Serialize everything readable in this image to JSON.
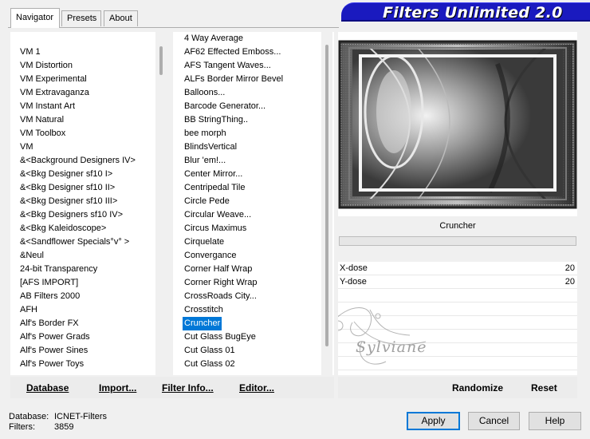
{
  "tabs": [
    {
      "label": "Navigator",
      "active": true
    },
    {
      "label": "Presets",
      "active": false
    },
    {
      "label": "About",
      "active": false
    }
  ],
  "banner_title": "Filters Unlimited 2.0",
  "categories": [
    "VM 1",
    "VM Distortion",
    "VM Experimental",
    "VM Extravaganza",
    "VM Instant Art",
    "VM Natural",
    "VM Toolbox",
    "VM",
    "&<Background Designers IV>",
    "&<Bkg Designer sf10 I>",
    "&<Bkg Designer sf10 II>",
    "&<Bkg Designer sf10 III>",
    "&<Bkg Designers sf10 IV>",
    "&<Bkg Kaleidoscope>",
    "&<Sandflower Specials°v° >",
    "&Neul",
    "24-bit Transparency",
    "[AFS IMPORT]",
    "AB Filters 2000",
    "AFH",
    "Alf's Border FX",
    "Alf's Power Grads",
    "Alf's Power Sines",
    "Alf's Power Toys"
  ],
  "filters": [
    "4 Way Average",
    "AF62 Effected Emboss...",
    "AFS Tangent Waves...",
    "ALFs Border Mirror Bevel",
    "Balloons...",
    "Barcode Generator...",
    "BB StringThing..",
    "bee morph",
    "BlindsVertical",
    "Blur 'em!...",
    "Center Mirror...",
    "Centripedal Tile",
    "Circle Pede",
    "Circular Weave...",
    "Circus Maximus",
    "Cirquelate",
    "Convergance",
    "Corner Half Wrap",
    "Corner Right Wrap",
    "CrossRoads City...",
    "Crosstitch",
    "Cruncher",
    "Cut Glass  BugEye",
    "Cut Glass 01",
    "Cut Glass 02"
  ],
  "selected_filter_index": 21,
  "preview": {
    "filter_name": "Cruncher",
    "watermark_text": "Sylviane"
  },
  "params": [
    {
      "label": "X-dose",
      "value": "20"
    },
    {
      "label": "Y-dose",
      "value": "20"
    }
  ],
  "toolbar": {
    "database": "Database",
    "import": "Import...",
    "filter_info": "Filter Info...",
    "editor": "Editor...",
    "randomize": "Randomize",
    "reset": "Reset"
  },
  "status": {
    "database_label": "Database:",
    "database_value": "ICNET-Filters",
    "filters_label": "Filters:",
    "filters_value": "3859"
  },
  "buttons": {
    "apply": "Apply",
    "cancel": "Cancel",
    "help": "Help"
  }
}
